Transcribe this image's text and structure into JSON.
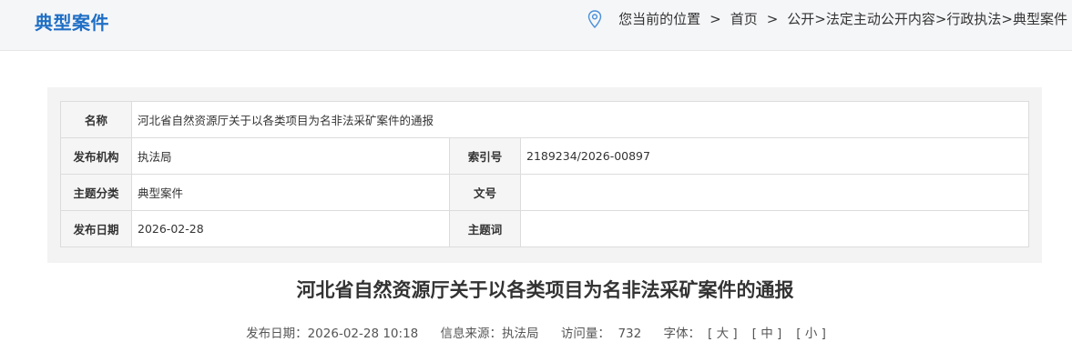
{
  "header": {
    "section_title": "典型案件",
    "location_label": "您当前的位置",
    "separator": ">",
    "home": "首页",
    "path": "公开>法定主动公开内容>行政执法>典型案件"
  },
  "meta": {
    "name_label": "名称",
    "name_value": "河北省自然资源厅关于以各类项目为名非法采矿案件的通报",
    "publisher_label": "发布机构",
    "publisher_value": "执法局",
    "index_label": "索引号",
    "index_value": "2189234/2026-00897",
    "topic_label": "主题分类",
    "topic_value": "典型案件",
    "docno_label": "文号",
    "docno_value": "",
    "date_label": "发布日期",
    "date_value": "2026-02-28",
    "keywords_label": "主题词",
    "keywords_value": ""
  },
  "article": {
    "title": "河北省自然资源厅关于以各类项目为名非法采矿案件的通报",
    "publish_time": "发布日期：2026-02-28 10:18",
    "source": "信息来源：执法局",
    "visits_label": "访问量：",
    "visits_value": "732",
    "font_label": "字体：",
    "font_large": "[ 大 ]",
    "font_medium": "[ 中 ]",
    "font_small": "[ 小 ]"
  },
  "colors": {
    "accent": "#1f6fc5",
    "header_bg": "#f5f6f8"
  }
}
